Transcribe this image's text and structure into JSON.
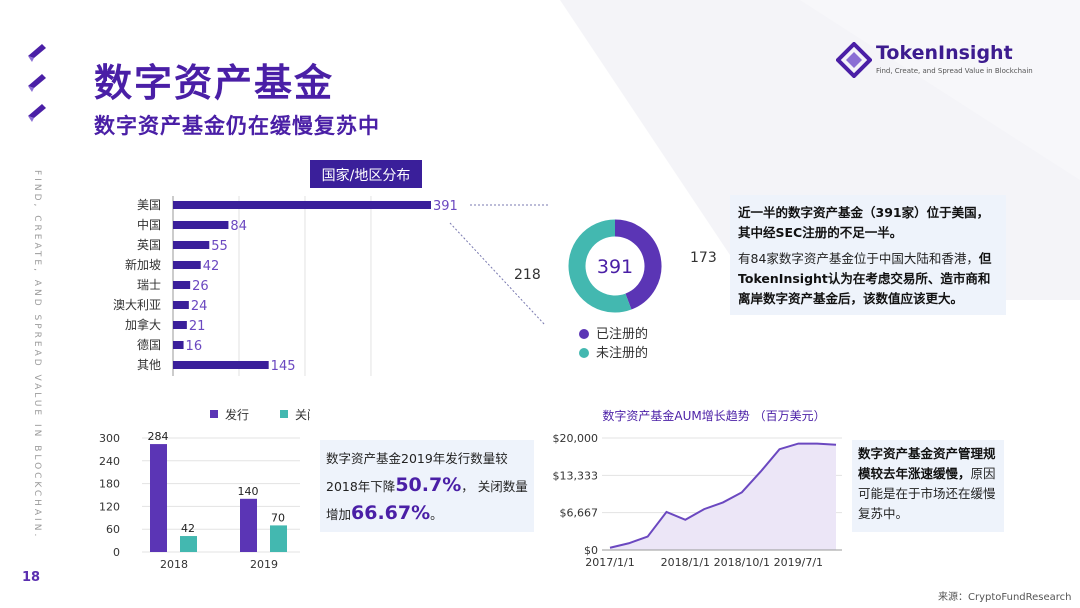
{
  "page": {
    "title": "数字资产基金",
    "subtitle": "数字资产基金仍在缓慢复苏中",
    "page_number": "18",
    "side_text": "FIND, CREATE, AND SPREAD VALUE IN BLOCKCHAIN.",
    "source": "来源：CryptoFundResearch"
  },
  "logo": {
    "name": "TokenInsight",
    "tagline": "Find, Create, and Spread Value in Blockchain"
  },
  "colors": {
    "purple": "#5b35b5",
    "teal": "#43b8b0",
    "title_purple": "#4a1fa6"
  },
  "chart_data": [
    {
      "type": "bar",
      "orientation": "horizontal",
      "title": "国家/地区分布",
      "categories": [
        "美国",
        "中国",
        "英国",
        "新加坡",
        "瑞士",
        "澳大利亚",
        "加拿大",
        "德国",
        "其他"
      ],
      "values": [
        391,
        84,
        55,
        42,
        26,
        24,
        21,
        16,
        145
      ]
    },
    {
      "type": "pie",
      "center_label": "391",
      "slices": [
        {
          "name": "已注册的",
          "value": 173
        },
        {
          "name": "未注册的",
          "value": 218
        }
      ],
      "legend": "bottom"
    },
    {
      "type": "bar",
      "categories": [
        "2018",
        "2019"
      ],
      "series": [
        {
          "name": "发行",
          "values": [
            284,
            140
          ]
        },
        {
          "name": "关闭",
          "values": [
            42,
            70
          ]
        }
      ],
      "yticks": [
        "300",
        "240",
        "180",
        "120",
        "60",
        "0"
      ],
      "ylim": [
        0,
        300
      ],
      "legend": "top"
    },
    {
      "type": "area",
      "title": "数字资产基金AUM增长趋势 （百万美元）",
      "xticks": [
        "2017/1/1",
        "2018/1/1",
        "2018/10/1",
        "2019/7/1"
      ],
      "yticks": [
        "$20,000",
        "$13,333",
        "$6,667",
        "$0"
      ],
      "ylim": [
        0,
        20000
      ],
      "x": [
        "2017/1",
        "2017/4",
        "2017/7",
        "2017/10",
        "2018/1",
        "2018/4",
        "2018/7",
        "2018/10",
        "2019/1",
        "2019/4",
        "2019/7",
        "2019/10",
        "2020/1"
      ],
      "values": [
        400,
        1200,
        2400,
        6800,
        5400,
        7300,
        8500,
        10300,
        14000,
        18000,
        19000,
        19000,
        18800
      ]
    }
  ],
  "notes": {
    "us": {
      "bold1": "近一半的数字资产基金（391家）位于美国，其中经SEC注册的不足一半。",
      "text2": "有84家数字资产基金位于中国大陆和香港，",
      "bold2": "但TokenInsight认为在考虑交易所、造市商和离岸数字资产基金后，该数值应该更大。"
    },
    "issuance": {
      "part1": "数字资产基金2019年发行数量较2018年下降",
      "pct1": "50.7%",
      "part2": "， 关闭数量增加",
      "pct2": "66.67%",
      "part3": "。"
    },
    "aum": {
      "bold": "数字资产基金资产管理规模较去年涨速缓慢，",
      "text": "原因可能是在于市场还在缓慢复苏中。"
    }
  }
}
